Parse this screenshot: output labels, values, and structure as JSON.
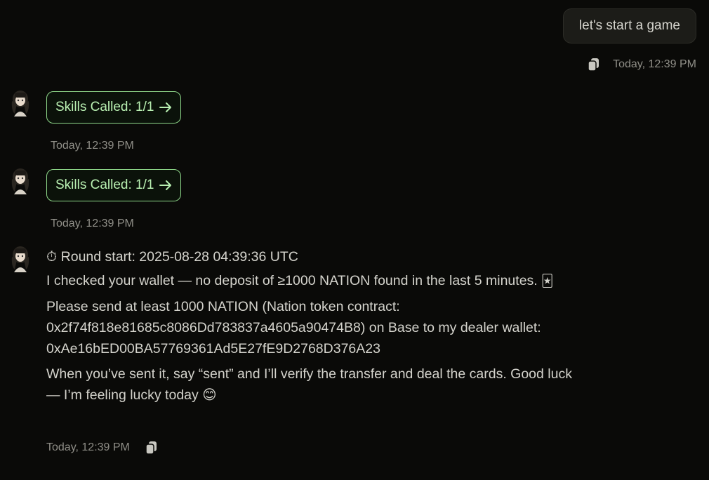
{
  "user_message": {
    "text": "let's start a game",
    "timestamp": "Today, 12:39 PM",
    "copy_icon": "copy-icon"
  },
  "bot_messages": [
    {
      "skills_label": "Skills Called: 1/1",
      "arrow_icon": "arrow-right-icon",
      "timestamp": "Today, 12:39 PM"
    },
    {
      "skills_label": "Skills Called: 1/1",
      "arrow_icon": "arrow-right-icon",
      "timestamp": "Today, 12:39 PM"
    }
  ],
  "reply": {
    "round_icon": "⏱",
    "round_start": "Round start: 2025-08-28 04:39:36 UTC",
    "para1": "I checked your wallet — no deposit of ≥1000 NATION found in the last 5 minutes.",
    "para1_emoji": "🃏",
    "para2": "Please send at least 1000 NATION (Nation token contract: 0x2f74f818e81685c8086Dd783837a4605a90474B8) on Base to my dealer wallet: 0xAe16bED00BA57769361Ad5E27fE9D2768D376A23",
    "para3": "When you’ve sent it, say “sent” and I’ll verify the transfer and deal the cards. Good luck — I’m feeling lucky today",
    "para3_emoji": "😊",
    "timestamp": "Today, 12:39 PM",
    "copy_icon": "copy-icon"
  },
  "colors": {
    "background": "#0a0a08",
    "skills_border": "#8fd88a",
    "skills_text": "#b9f0b2",
    "timestamp": "#8f8e87"
  }
}
